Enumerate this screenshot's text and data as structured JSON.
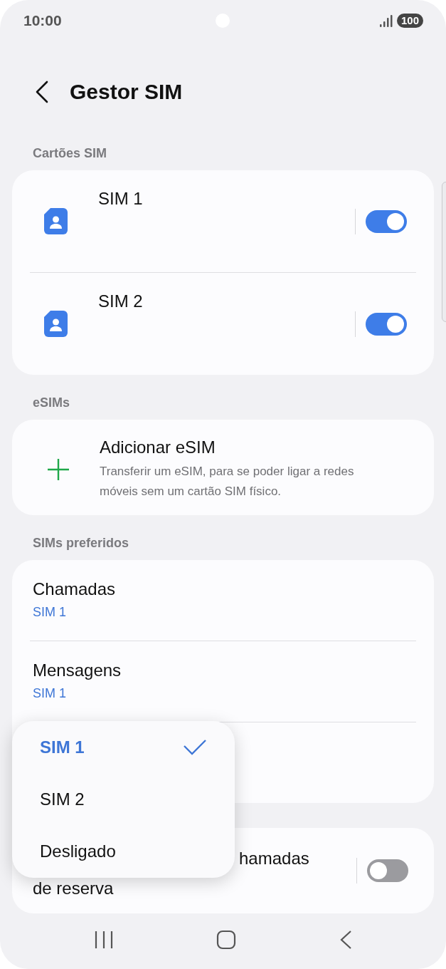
{
  "status_bar": {
    "time": "10:00",
    "battery": "100"
  },
  "header": {
    "title": "Gestor SIM"
  },
  "sim_cards": {
    "label": "Cartões SIM",
    "items": [
      {
        "title": "SIM 1",
        "on": true
      },
      {
        "title": "SIM 2",
        "on": true
      }
    ]
  },
  "esims": {
    "label": "eSIMs",
    "items": [
      {
        "title": "Adicionar eSIM",
        "description": "Transferir um eSIM, para se poder ligar a redes móveis sem um cartão SIM físico."
      }
    ]
  },
  "preferred_sims": {
    "label": "SIMs preferidos",
    "items": [
      {
        "title": "Chamadas",
        "value": "SIM 1"
      },
      {
        "title": "Mensagens",
        "value": "SIM 1"
      }
    ]
  },
  "backup_calls": {
    "line_1": "hamadas",
    "line_2": "de reserva",
    "on": false
  },
  "dropdown": {
    "options": [
      {
        "label": "SIM 1",
        "selected": true
      },
      {
        "label": "SIM 2",
        "selected": false
      },
      {
        "label": "Desligado",
        "selected": false
      }
    ]
  }
}
